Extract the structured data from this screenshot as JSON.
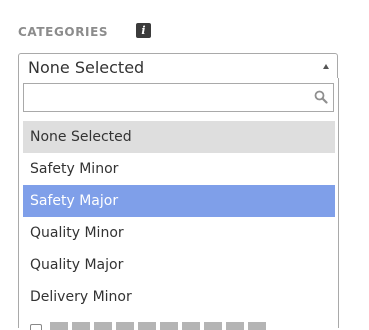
{
  "section": {
    "label": "CATEGORIES",
    "info_icon_glyph": "i"
  },
  "select": {
    "value": "None Selected",
    "caret_icon": "caret-up-icon"
  },
  "search": {
    "placeholder": "",
    "value": "",
    "icon": "search-icon"
  },
  "options": [
    {
      "label": "None Selected",
      "state": "disabled"
    },
    {
      "label": "Safety Minor",
      "state": "normal"
    },
    {
      "label": "Safety Major",
      "state": "highlighted"
    },
    {
      "label": "Quality Minor",
      "state": "normal"
    },
    {
      "label": "Quality Major",
      "state": "normal"
    },
    {
      "label": "Delivery Minor",
      "state": "normal"
    }
  ],
  "colors": {
    "highlight": "#7f9fe9",
    "disabled_bg": "#dedede",
    "label_gray": "#8c8c8c",
    "info_icon_bg": "#3b3b3b"
  }
}
